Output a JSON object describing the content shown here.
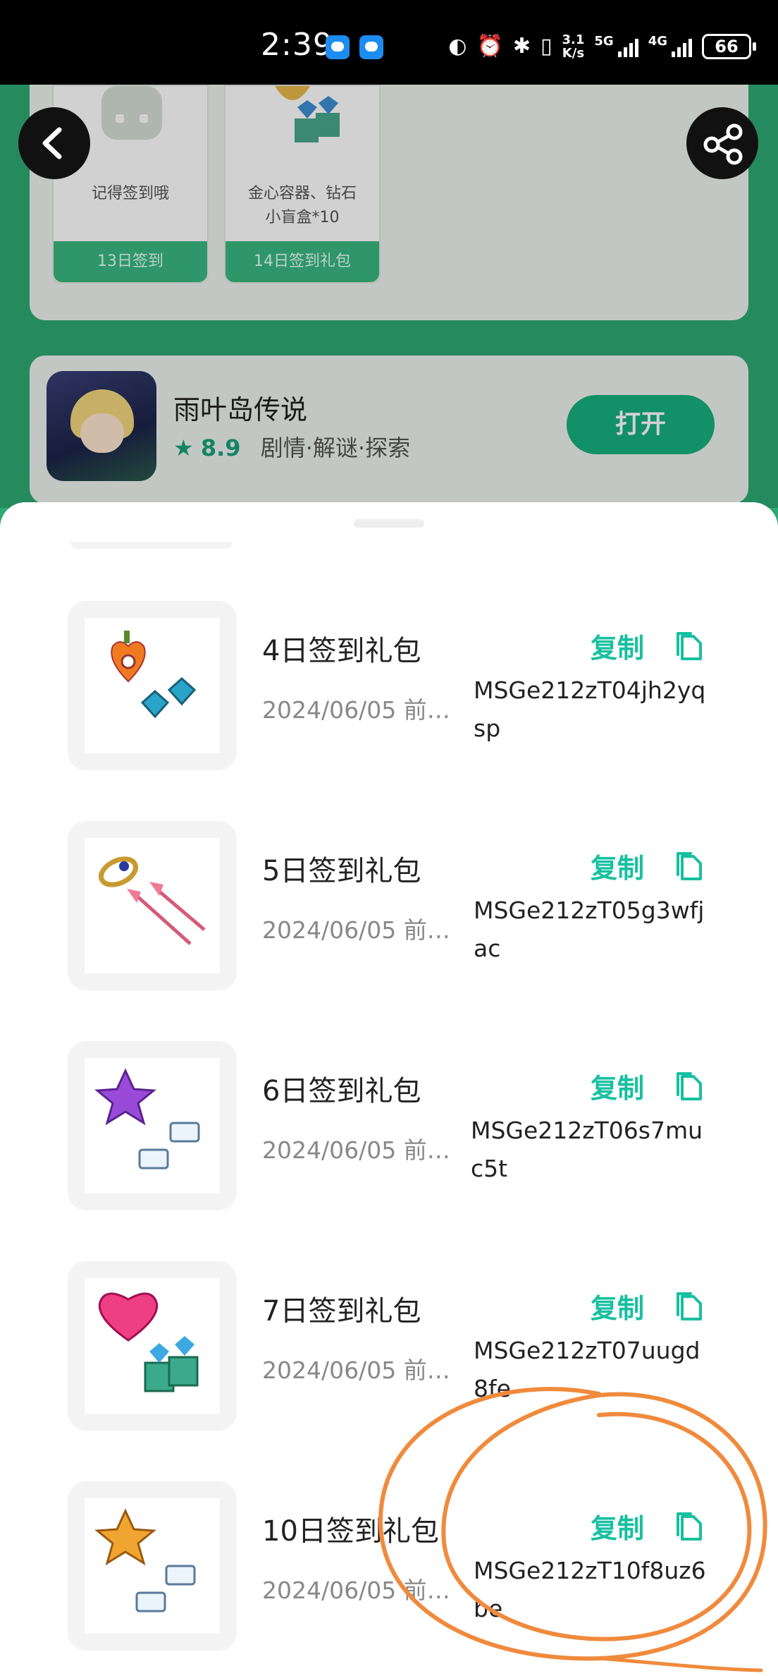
{
  "status_bar": {
    "time": "2:39",
    "speed_top": "3.1",
    "speed_bottom": "K/s",
    "net1": "5G",
    "net2": "4G",
    "battery": "66"
  },
  "rewards": [
    {
      "text": "记得签到哦",
      "tag": "13日签到"
    },
    {
      "text": "金心容器、钻石\n小盲盒*10",
      "tag": "14日签到礼包"
    }
  ],
  "game": {
    "name": "雨叶岛传说",
    "rating": "8.9",
    "tags": "剧情·解谜·探索",
    "open_label": "打开"
  },
  "gifts": [
    {
      "title": "4日签到礼包",
      "date": "2024/06/05 前…",
      "copy_label": "复制",
      "code": "MSGe212zT04jh2yqsp"
    },
    {
      "title": "5日签到礼包",
      "date": "2024/06/05 前…",
      "copy_label": "复制",
      "code": "MSGe212zT05g3wfjac"
    },
    {
      "title": "6日签到礼包",
      "date": "2024/06/05 前…",
      "copy_label": "复制",
      "code": "MSGe212zT06s7muc5t"
    },
    {
      "title": "7日签到礼包",
      "date": "2024/06/05 前…",
      "copy_label": "复制",
      "code": "MSGe212zT07uugd8fe"
    },
    {
      "title": "10日签到礼包",
      "date": "2024/06/05 前…",
      "copy_label": "复制",
      "code": "MSGe212zT10f8uz6be"
    }
  ],
  "colors": {
    "accent": "#17c0a0",
    "brand_green": "#2eaa73",
    "annotation": "#f08a3c"
  }
}
